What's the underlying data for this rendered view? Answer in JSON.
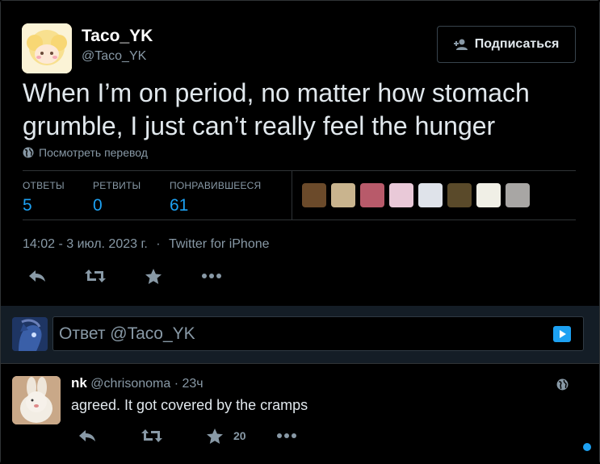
{
  "author": {
    "display_name": "Taco_YK",
    "handle": "@Taco_YK"
  },
  "follow_button": {
    "label": "Подписаться"
  },
  "tweet": {
    "text": "When I’m on period, no matter how stomach grumble, I just can’t really feel the hunger",
    "translate_label": "Посмотреть перевод",
    "timestamp": "14:02 - 3 июл. 2023 г.",
    "separator": "·",
    "source": "Twitter for iPhone"
  },
  "stats": [
    {
      "label": "ОТВЕТЫ",
      "value": "5"
    },
    {
      "label": "РЕТВИТЫ",
      "value": "0"
    },
    {
      "label": "ПОНРАВИВШЕЕСЯ",
      "value": "61"
    }
  ],
  "likers": [
    {
      "color": "#6b4a2a"
    },
    {
      "color": "#c9b48e"
    },
    {
      "color": "#b85a6a"
    },
    {
      "color": "#e9c9d8"
    },
    {
      "color": "#dfe3ea"
    },
    {
      "color": "#5a4a2a"
    },
    {
      "color": "#f0efe6"
    },
    {
      "color": "#a8a6a4"
    }
  ],
  "reply_box": {
    "placeholder": "Ответ @Taco_YK"
  },
  "comment": {
    "display_name": "nk",
    "handle": "@chrisonoma",
    "dot": "·",
    "time": "23ч",
    "text": "agreed. It got covered by the cramps",
    "like_count": "20"
  },
  "colors": {
    "accent": "#1da1f2",
    "muted": "#8899a6",
    "background": "#000000",
    "reply_area": "#141d26"
  }
}
